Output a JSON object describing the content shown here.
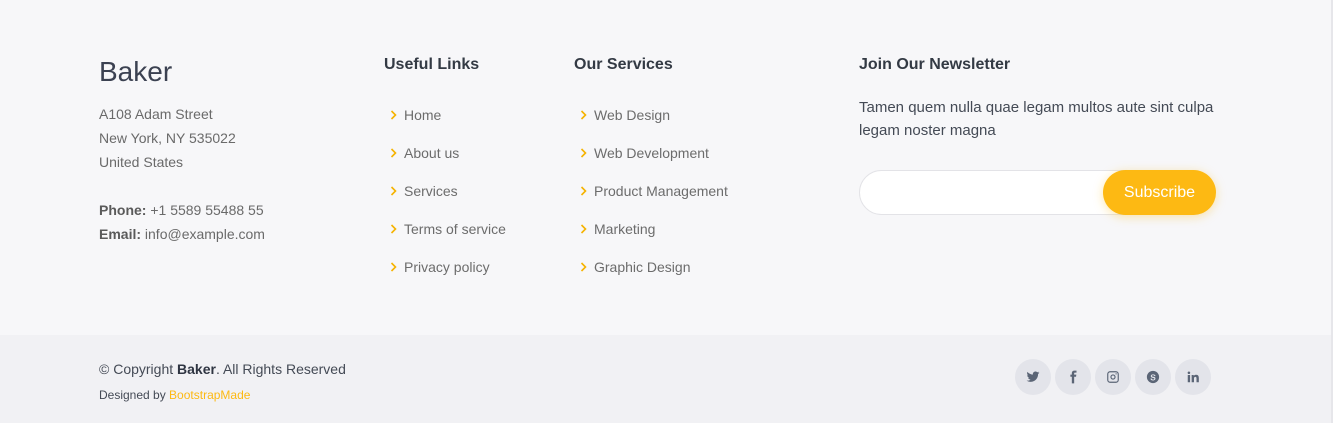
{
  "brand": {
    "name": "Baker",
    "address_line1": "A108 Adam Street",
    "address_line2": "New York, NY 535022",
    "address_line3": "United States",
    "phone_label": "Phone:",
    "phone": "+1 5589 55488 55",
    "email_label": "Email:",
    "email": "info@example.com"
  },
  "useful_links": {
    "title": "Useful Links",
    "items": [
      "Home",
      "About us",
      "Services",
      "Terms of service",
      "Privacy policy"
    ]
  },
  "services": {
    "title": "Our Services",
    "items": [
      "Web Design",
      "Web Development",
      "Product Management",
      "Marketing",
      "Graphic Design"
    ]
  },
  "newsletter": {
    "title": "Join Our Newsletter",
    "text": "Tamen quem nulla quae legam multos aute sint culpa legam noster magna",
    "input_value": "",
    "button_label": "Subscribe"
  },
  "bottom": {
    "copyright_prefix": "© Copyright ",
    "copyright_brand": "Baker",
    "copyright_suffix": ". All Rights Reserved",
    "designed_by": "Designed by ",
    "designer": "BootstrapMade"
  },
  "social": [
    "twitter-icon",
    "facebook-icon",
    "instagram-icon",
    "skype-icon",
    "linkedin-icon"
  ],
  "colors": {
    "accent": "#fdb913",
    "footer_top_bg": "#f7f7f9",
    "footer_bottom_bg": "#f1f1f4",
    "social_bg": "#e3e4ea"
  }
}
